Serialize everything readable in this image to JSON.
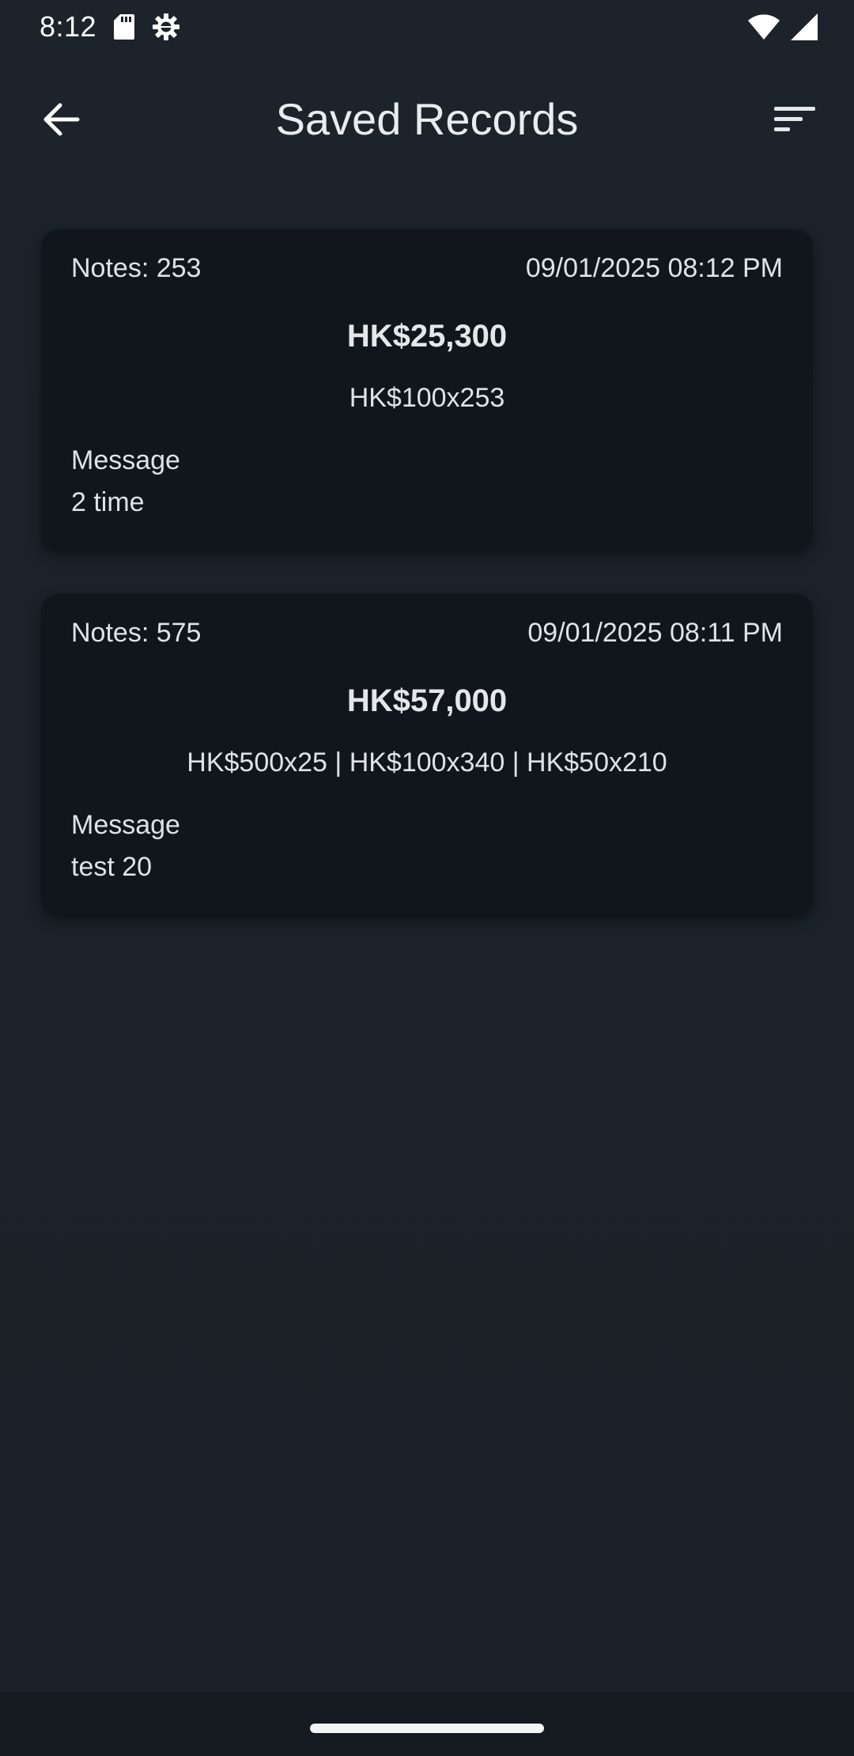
{
  "status_bar": {
    "time": "8:12",
    "icons_left": [
      "sd-card-icon",
      "gear-icon"
    ],
    "icons_right": [
      "wifi-icon",
      "cell-signal-icon"
    ]
  },
  "app_bar": {
    "title": "Saved Records",
    "back_icon": "arrow-left-icon",
    "sort_icon": "sort-icon"
  },
  "records": [
    {
      "notes": "Notes: 253",
      "datetime": "09/01/2025 08:12 PM",
      "amount": "HK$25,300",
      "breakdown": "HK$100x253",
      "message_label": "Message",
      "message": "2 time"
    },
    {
      "notes": "Notes: 575",
      "datetime": "09/01/2025 08:11 PM",
      "amount": "HK$57,000",
      "breakdown": "HK$500x25 | HK$100x340 | HK$50x210",
      "message_label": "Message",
      "message": "test 20"
    }
  ],
  "colors": {
    "background": "#1b2229",
    "card": "#10161c",
    "text": "#e6e9ec"
  }
}
